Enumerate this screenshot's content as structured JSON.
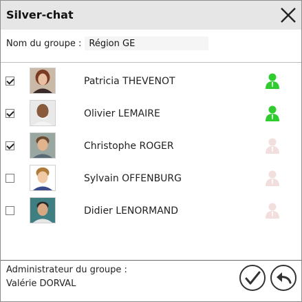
{
  "window": {
    "title": "Silver-chat",
    "close_icon": "close-icon"
  },
  "group": {
    "name_label": "Nom du groupe :",
    "name_value": "Région GE"
  },
  "members": [
    {
      "name": "Patricia THEVENOT",
      "checked": true,
      "online": true,
      "avatar": "avatar-photo"
    },
    {
      "name": "Olivier LEMAIRE",
      "checked": true,
      "online": true,
      "avatar": "avatar-photo"
    },
    {
      "name": "Christophe ROGER",
      "checked": true,
      "online": false,
      "avatar": "avatar-photo"
    },
    {
      "name": "Sylvain OFFENBURG",
      "checked": false,
      "online": false,
      "avatar": "avatar-photo"
    },
    {
      "name": "Didier LENORMAND",
      "checked": false,
      "online": false,
      "avatar": "avatar-photo"
    }
  ],
  "footer": {
    "admin_label": "Administrateur du groupe :",
    "admin_name": "Valérie DORVAL",
    "confirm_icon": "checkmark-icon",
    "back_icon": "back-arrow-icon"
  },
  "colors": {
    "titlebar": "#e6e6e6",
    "online_status": "#2ecc2e",
    "offline_status": "#f3dede"
  }
}
